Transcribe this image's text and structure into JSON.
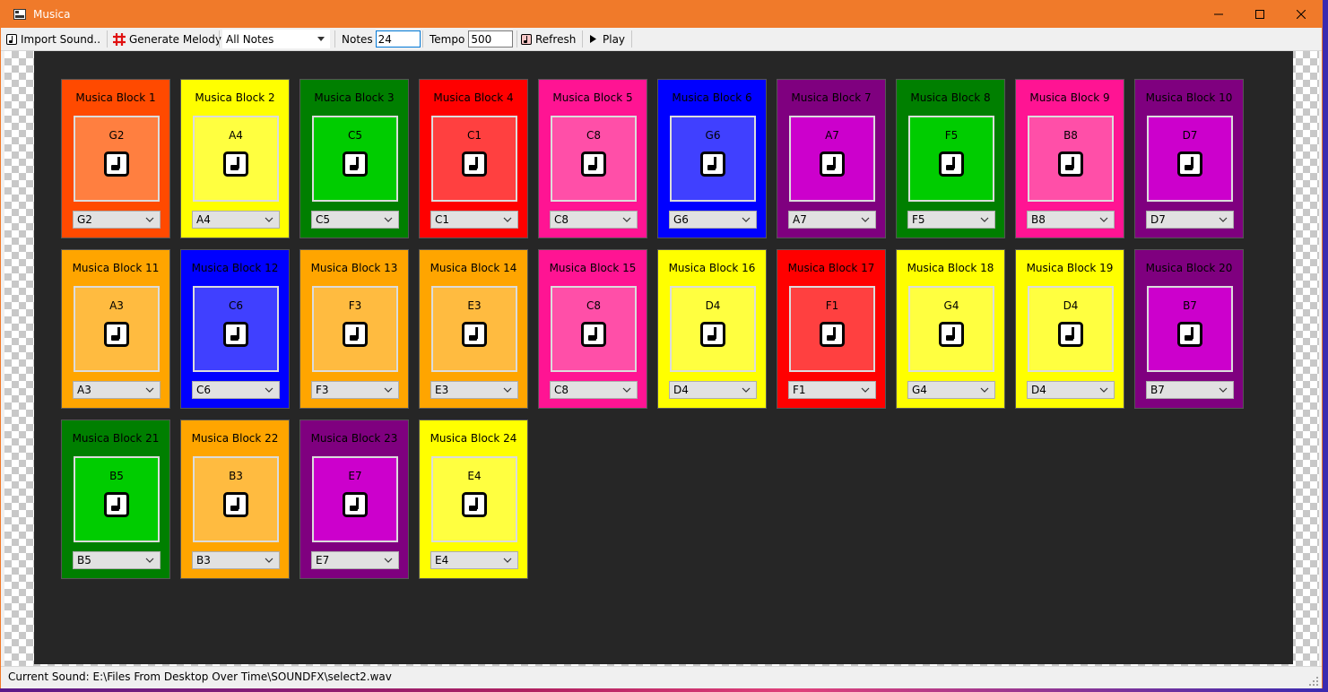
{
  "window": {
    "title": "Musica"
  },
  "toolbar": {
    "import_label": "Import Sound..",
    "generate_label": "Generate Melody",
    "filter_value": "All Notes",
    "notes_label": "Notes",
    "notes_value": "24",
    "tempo_label": "Tempo",
    "tempo_value": "500",
    "refresh_label": "Refresh",
    "play_label": "Play"
  },
  "blocks": [
    {
      "name": "Musica Block 1",
      "note": "G2",
      "color": "#ff4a00",
      "pad_color": "#ff7f40"
    },
    {
      "name": "Musica Block 2",
      "note": "A4",
      "color": "#ffff00",
      "pad_color": "#ffff40"
    },
    {
      "name": "Musica Block 3",
      "note": "C5",
      "color": "#007f00",
      "pad_color": "#00cc00"
    },
    {
      "name": "Musica Block 4",
      "note": "C1",
      "color": "#ff0000",
      "pad_color": "#ff4040"
    },
    {
      "name": "Musica Block 5",
      "note": "C8",
      "color": "#ff1493",
      "pad_color": "#ff4fa8"
    },
    {
      "name": "Musica Block 6",
      "note": "G6",
      "color": "#0000ff",
      "pad_color": "#4040ff"
    },
    {
      "name": "Musica Block 7",
      "note": "A7",
      "color": "#7f007f",
      "pad_color": "#cc00cc"
    },
    {
      "name": "Musica Block 8",
      "note": "F5",
      "color": "#007f00",
      "pad_color": "#00cc00"
    },
    {
      "name": "Musica Block 9",
      "note": "B8",
      "color": "#ff1493",
      "pad_color": "#ff4fa8"
    },
    {
      "name": "Musica Block 10",
      "note": "D7",
      "color": "#7f007f",
      "pad_color": "#cc00cc"
    },
    {
      "name": "Musica Block 11",
      "note": "A3",
      "color": "#ffa500",
      "pad_color": "#ffbb40"
    },
    {
      "name": "Musica Block 12",
      "note": "C6",
      "color": "#0000ff",
      "pad_color": "#4040ff"
    },
    {
      "name": "Musica Block 13",
      "note": "F3",
      "color": "#ffa500",
      "pad_color": "#ffbb40"
    },
    {
      "name": "Musica Block 14",
      "note": "E3",
      "color": "#ffa500",
      "pad_color": "#ffbb40"
    },
    {
      "name": "Musica Block 15",
      "note": "C8",
      "color": "#ff1493",
      "pad_color": "#ff4fa8"
    },
    {
      "name": "Musica Block 16",
      "note": "D4",
      "color": "#ffff00",
      "pad_color": "#ffff40"
    },
    {
      "name": "Musica Block 17",
      "note": "F1",
      "color": "#ff0000",
      "pad_color": "#ff4040"
    },
    {
      "name": "Musica Block 18",
      "note": "G4",
      "color": "#ffff00",
      "pad_color": "#ffff40"
    },
    {
      "name": "Musica Block 19",
      "note": "D4",
      "color": "#ffff00",
      "pad_color": "#ffff40"
    },
    {
      "name": "Musica Block 20",
      "note": "B7",
      "color": "#7f007f",
      "pad_color": "#cc00cc"
    },
    {
      "name": "Musica Block 21",
      "note": "B5",
      "color": "#007f00",
      "pad_color": "#00cc00"
    },
    {
      "name": "Musica Block 22",
      "note": "B3",
      "color": "#ffa500",
      "pad_color": "#ffbb40"
    },
    {
      "name": "Musica Block 23",
      "note": "E7",
      "color": "#7f007f",
      "pad_color": "#cc00cc"
    },
    {
      "name": "Musica Block 24",
      "note": "E4",
      "color": "#ffff00",
      "pad_color": "#ffff40"
    }
  ],
  "status": {
    "text": "Current Sound: E:\\Files From Desktop Over Time\\SOUNDFX\\select2.wav"
  },
  "icons": {
    "app": "app-window-icon",
    "import": "music-note-icon",
    "generate": "hash-icon",
    "refresh": "music-note-icon",
    "play": "play-triangle-icon",
    "block_pad": "music-note-icon"
  },
  "theme": {
    "titlebar": "#f07a2a",
    "canvas": "#262626"
  }
}
